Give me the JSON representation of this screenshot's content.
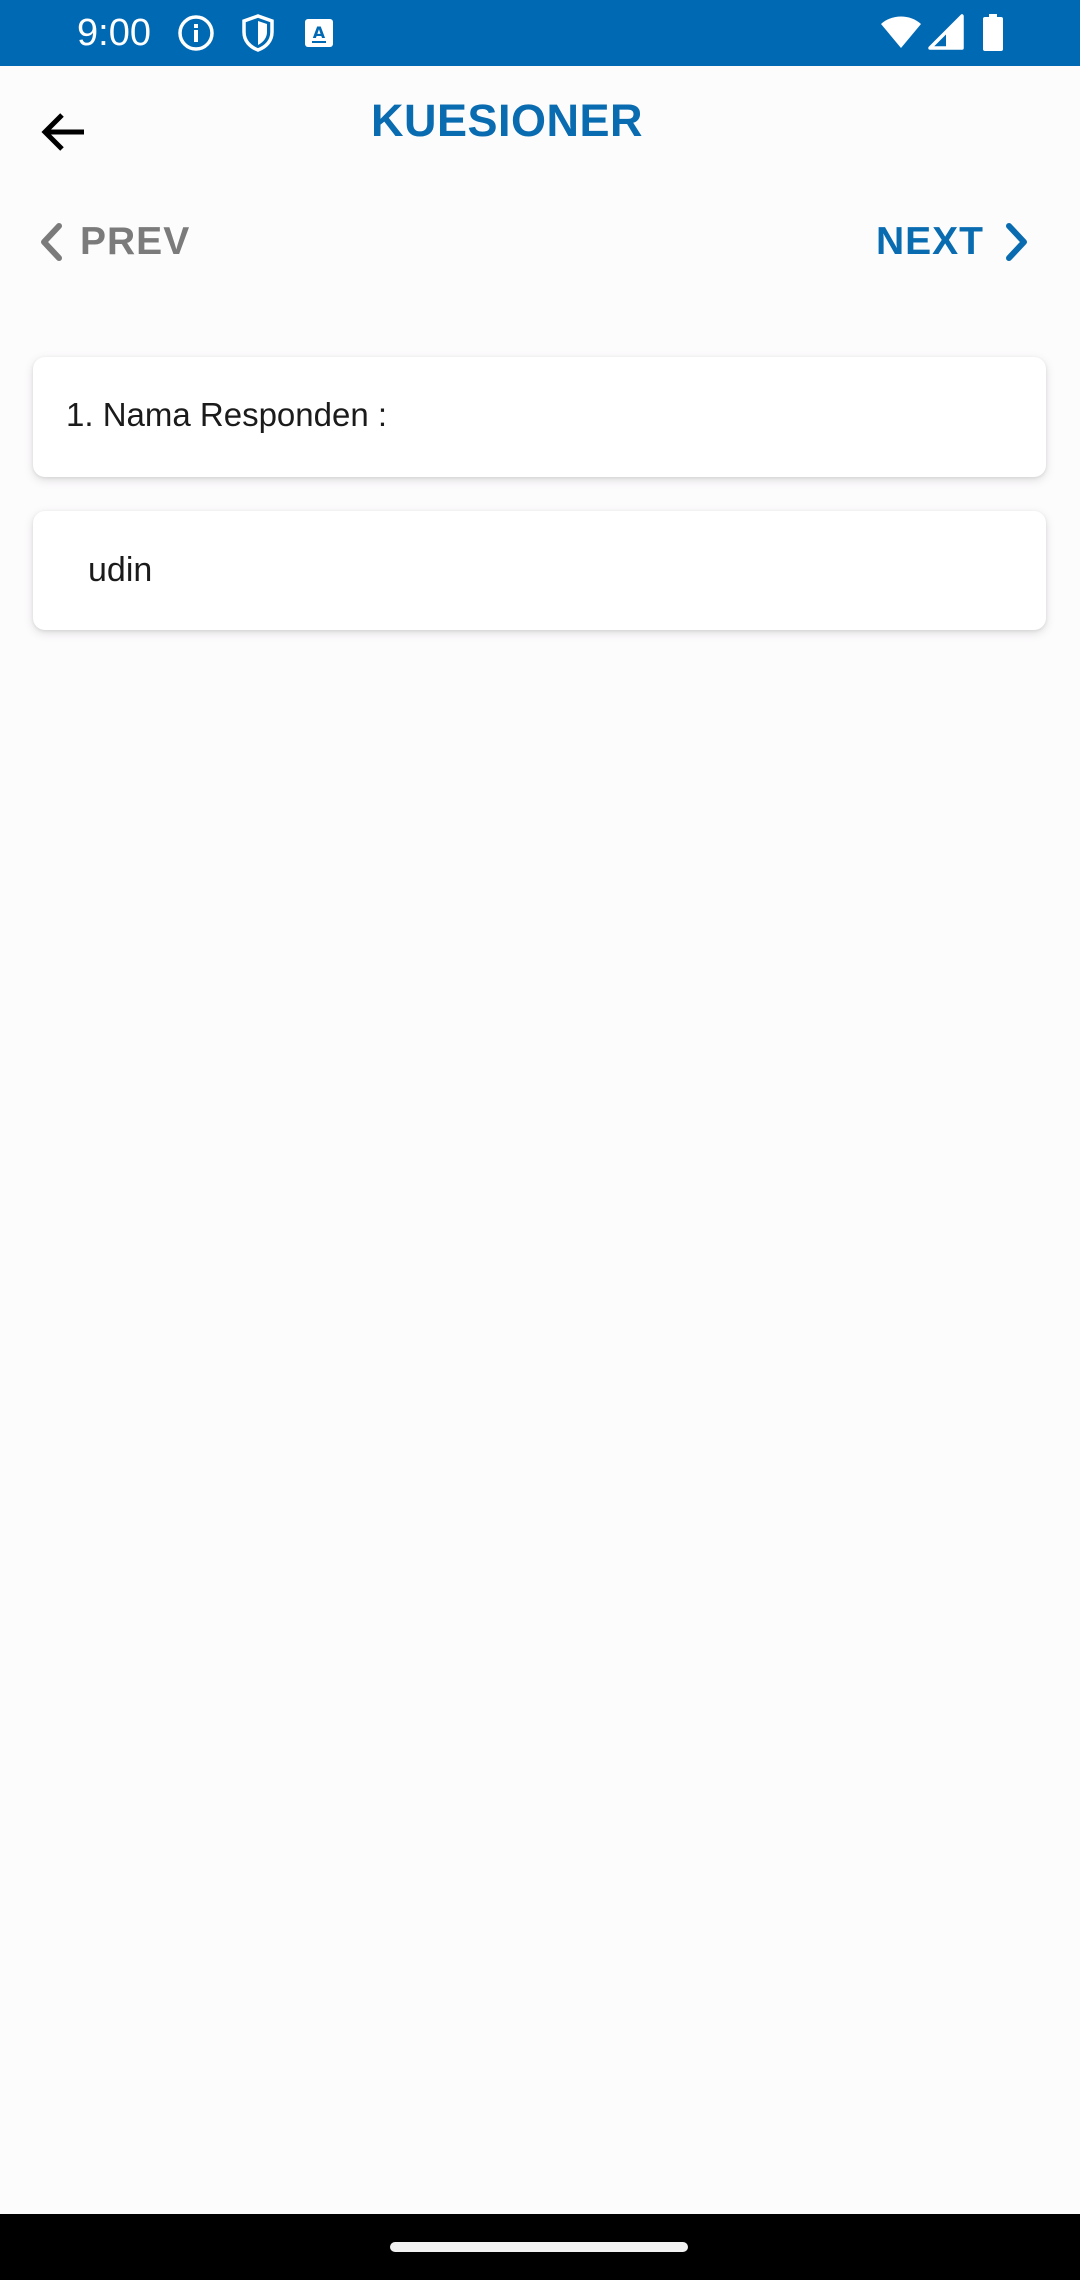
{
  "status_bar": {
    "time": "9:00",
    "background_color": "#0069b3",
    "left_icons": [
      "info-icon",
      "shield-icon",
      "keyboard-a-icon"
    ],
    "right_icons": [
      "wifi-icon",
      "cellular-icon",
      "battery-icon"
    ]
  },
  "app_bar": {
    "title": "KUESIONER",
    "back_icon": "arrow-left-icon",
    "title_color": "#0a6cb0"
  },
  "navigation": {
    "prev_label": "PREV",
    "next_label": "NEXT",
    "prev_color": "#7b7b7b",
    "next_color": "#0a6cb0"
  },
  "question": {
    "text": "1. Nama Responden :"
  },
  "answer": {
    "value": "udin",
    "placeholder": ""
  }
}
